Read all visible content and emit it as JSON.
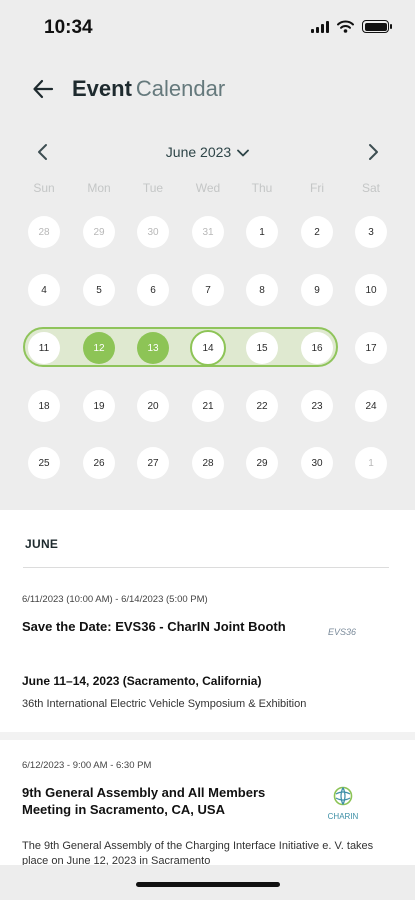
{
  "status_bar": {
    "time": "10:34"
  },
  "header": {
    "title_bold": "Event",
    "title_light": "Calendar"
  },
  "calendar": {
    "month_label": "June 2023",
    "weekdays": [
      "Sun",
      "Mon",
      "Tue",
      "Wed",
      "Thu",
      "Fri",
      "Sat"
    ],
    "weeks": [
      [
        "28",
        "29",
        "30",
        "31",
        "1",
        "2",
        "3"
      ],
      [
        "4",
        "5",
        "6",
        "7",
        "8",
        "9",
        "10"
      ],
      [
        "11",
        "12",
        "13",
        "14",
        "15",
        "16",
        "17"
      ],
      [
        "18",
        "19",
        "20",
        "21",
        "22",
        "23",
        "24"
      ],
      [
        "25",
        "26",
        "27",
        "28",
        "29",
        "30",
        "1"
      ]
    ],
    "highlighted_range": "11 - 16",
    "selected_days": [
      "12",
      "13"
    ],
    "today": "14",
    "accent_color": "#8dc456"
  },
  "list": {
    "section_label": "JUNE",
    "events": [
      {
        "date_range": "6/11/2023 (10:00 AM) - 6/14/2023 (5:00 PM)",
        "title": "Save the Date: EVS36 - CharIN Joint Booth",
        "subtitle": "June 11–14, 2023 (Sacramento, California)",
        "description": "36th International Electric Vehicle Symposium & Exhibition",
        "logo_text": "EVS36"
      },
      {
        "date_range": "6/12/2023 - 9:00 AM - 6:30 PM",
        "title": "9th General Assembly and All Members Meeting in Sacramento, CA, USA",
        "description": "The 9th General Assembly of the Charging Interface Initiative e. V. takes place on June 12, 2023 in Sacramento",
        "logo_text": "CHARIN"
      }
    ]
  }
}
